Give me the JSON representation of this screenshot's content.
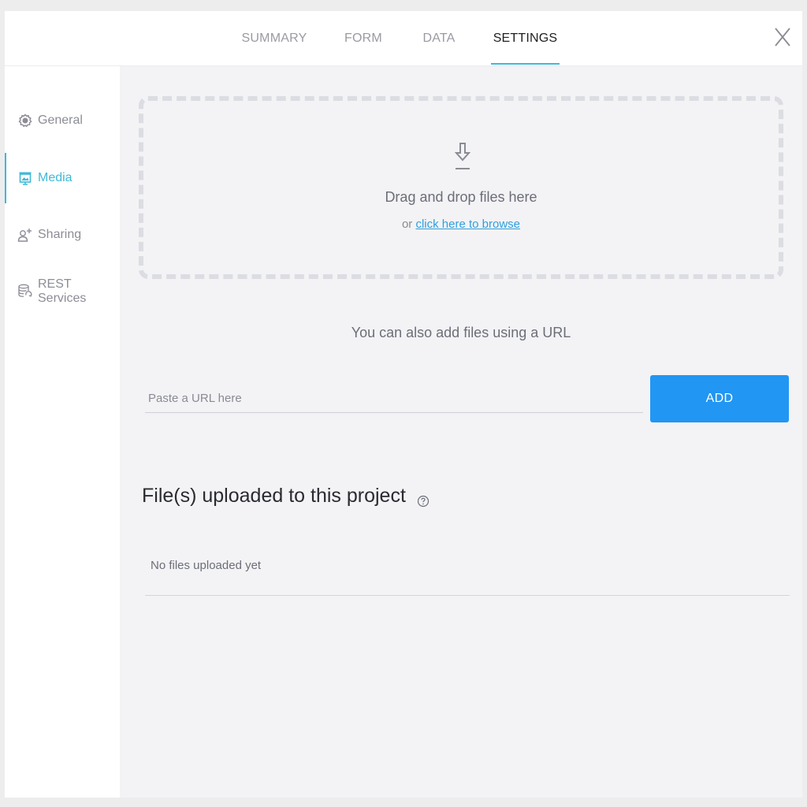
{
  "tabs": [
    {
      "label": "SUMMARY",
      "active": false
    },
    {
      "label": "FORM",
      "active": false
    },
    {
      "label": "DATA",
      "active": false
    },
    {
      "label": "SETTINGS",
      "active": true
    }
  ],
  "close_icon": "close-icon",
  "sidebar": {
    "items": [
      {
        "label": "General",
        "icon": "gear-icon",
        "active": false
      },
      {
        "label": "Media",
        "icon": "media-icon",
        "active": true
      },
      {
        "label": "Sharing",
        "icon": "add-user-icon",
        "active": false
      },
      {
        "label": "REST Services",
        "icon": "database-sync-icon",
        "active": false
      }
    ]
  },
  "dropzone": {
    "icon": "download-icon",
    "title": "Drag and drop files here",
    "sub_prefix": "or",
    "browse_link": "click here to browse"
  },
  "url_section": {
    "hint": "You can also add files using a URL",
    "placeholder": "Paste a URL here",
    "value": "",
    "add_label": "ADD"
  },
  "files_section": {
    "title": "File(s) uploaded to this project",
    "help_icon": "help-icon",
    "empty_text": "No files uploaded yet"
  },
  "colors": {
    "accent": "#3fb9d7",
    "primary_button": "#2196f3",
    "link": "#2f9fde",
    "main_bg": "#f3f3f5"
  }
}
